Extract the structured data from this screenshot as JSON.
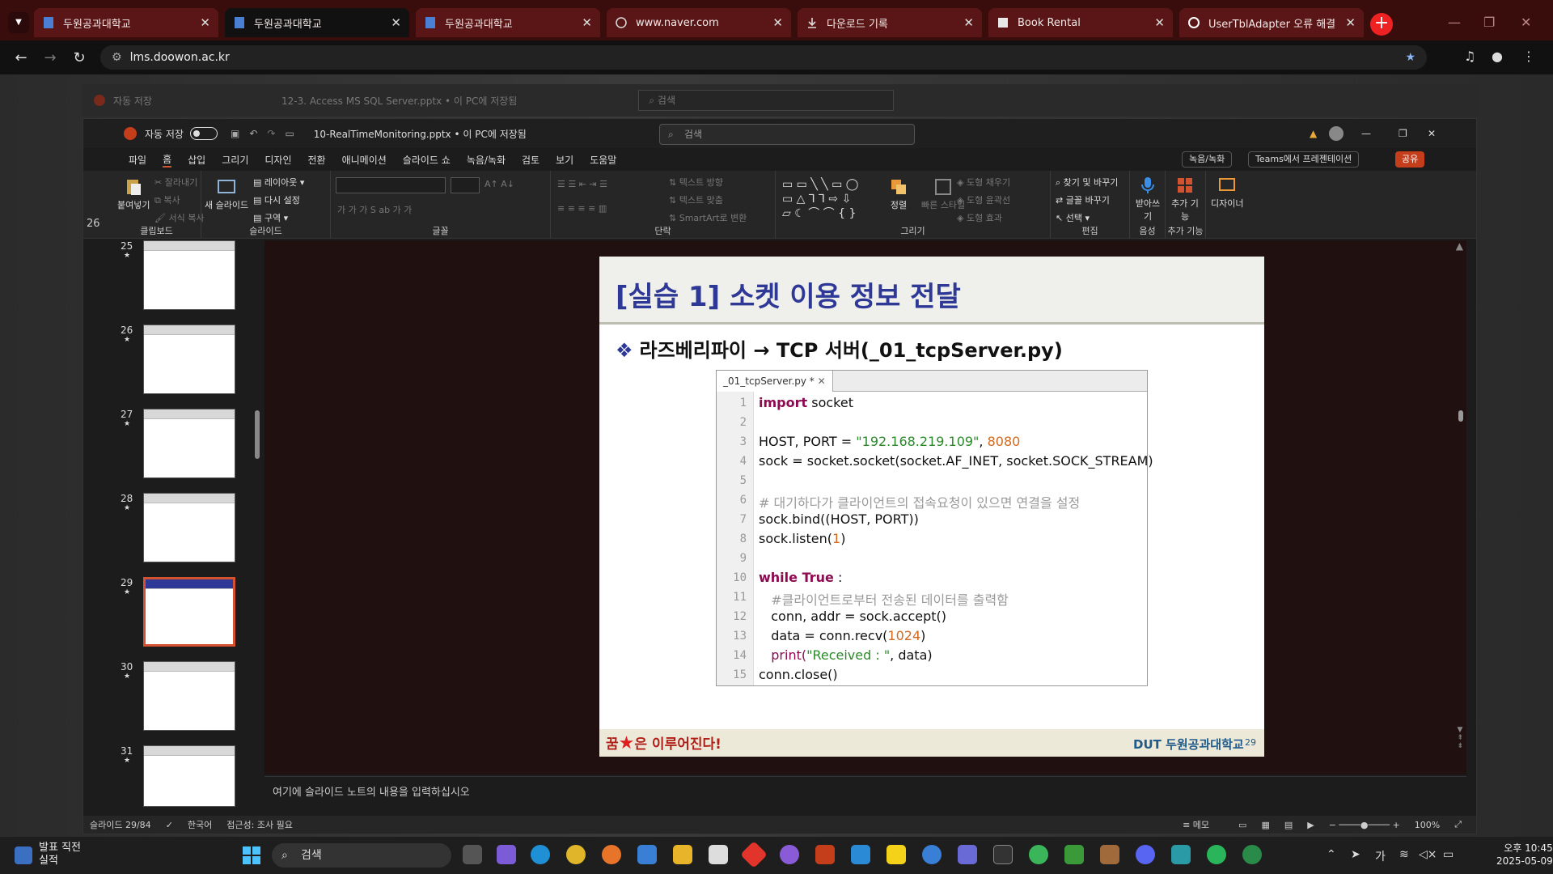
{
  "browser": {
    "tabs": [
      {
        "title": "두원공과대학교",
        "active": false
      },
      {
        "title": "두원공과대학교",
        "active": true
      },
      {
        "title": "두원공과대학교",
        "active": false
      },
      {
        "title": "www.naver.com",
        "active": false
      },
      {
        "title": "다운로드 기록",
        "active": false
      },
      {
        "title": "Book Rental",
        "active": false
      },
      {
        "title": "UserTblAdapter 오류 해결",
        "active": false
      }
    ],
    "url": "lms.doowon.ac.kr"
  },
  "back_window": {
    "autosave": "자동 저장",
    "filename": "12-3. Access MS SQL Server.pptx • 이 PC에 저장됨",
    "search": "검색"
  },
  "ppt": {
    "autosave_label": "자동 저장",
    "toggle_state": "끔",
    "filename": "10-RealTimeMonitoring.pptx • 이 PC에 저장됨",
    "search_placeholder": "검색",
    "menu": [
      "파일",
      "홈",
      "삽입",
      "그리기",
      "디자인",
      "전환",
      "애니메이션",
      "슬라이드 쇼",
      "녹음/녹화",
      "검토",
      "보기",
      "도움말"
    ],
    "buttons": {
      "record": "녹음/녹화",
      "teams": "Teams에서 프레젠테이션",
      "share": "공유"
    },
    "ribbon": {
      "groups": [
        "클립보드",
        "슬라이드",
        "글꼴",
        "단락",
        "그리기",
        "편집",
        "음성",
        "추가 기능"
      ],
      "paste": "붙여넣기",
      "cut": "잘라내기",
      "copy": "복사",
      "format_copy": "서식 복사",
      "new_slide": "새 슬라이드",
      "layout": "레이아웃",
      "reset": "다시 설정",
      "section": "구역",
      "text_direction": "텍스트 방향",
      "text_align": "텍스트 맞춤",
      "smartart": "SmartArt로 변환",
      "arrange": "정렬",
      "quick_styles": "빠른 스타일",
      "shape_fill": "도형 채우기",
      "shape_outline": "도형 윤곽선",
      "shape_effects": "도형 효과",
      "find": "찾기 및 바꾸기",
      "replace": "글꼴 바꾸기",
      "select": "선택",
      "dictate": "받아쓰기",
      "addins": "추가 기능",
      "designer": "디자이너"
    },
    "left_numbers": [
      "26",
      "27",
      "28",
      "29",
      "30"
    ],
    "thumbnails": [
      {
        "num": "25",
        "selected": false
      },
      {
        "num": "26",
        "selected": false
      },
      {
        "num": "27",
        "selected": false
      },
      {
        "num": "28",
        "selected": false
      },
      {
        "num": "29",
        "selected": true
      },
      {
        "num": "30",
        "selected": false
      },
      {
        "num": "31",
        "selected": false
      }
    ],
    "slide": {
      "title": "[실습 1] 소켓 이용 정보 전달",
      "bullet_bullet": "❖",
      "bullet_text": "라즈베리파이 → TCP 서버(_01_tcpServer.py)",
      "editor_tab": "_01_tcpServer.py *",
      "line_numbers": [
        "1",
        "2",
        "3",
        "4",
        "5",
        "6",
        "7",
        "8",
        "9",
        "10",
        "11",
        "12",
        "13",
        "14",
        "15"
      ],
      "code": {
        "l1_kw": "import",
        "l1_rest": " socket",
        "l3_a": "HOST, PORT = ",
        "l3_str": "\"192.168.219.109\"",
        "l3_b": ", ",
        "l3_num": "8080",
        "l4": "sock = socket.socket(socket.AF_INET, socket.SOCK_STREAM)",
        "l6": "# 대기하다가 클라이언트의 접속요청이 있으면 연결을 설정",
        "l7": "sock.bind((HOST, PORT))",
        "l8_a": "sock.listen(",
        "l8_num": "1",
        "l8_b": ")",
        "l10_kw": "while True",
        "l10_rest": " :",
        "l11": "   #클라이언트로부터 전송된 데이터를 출력함",
        "l12": "   conn, addr = sock.accept()",
        "l13_a": "   data = conn.recv(",
        "l13_num": "1024",
        "l13_b": ")",
        "l14_fn": "   print(",
        "l14_str": "\"Received : \"",
        "l14_b": ", data)",
        "l15": "conn.close()"
      },
      "motto_a": "꿈",
      "motto_star": "★",
      "motto_b": "은 이루어진다!",
      "footer_logo": "DUT 두원공과대학교",
      "page_number": "29"
    },
    "notes_placeholder": "여기에 슬라이드 노트의 내용을 입력하십시오",
    "status": {
      "slide": "슬라이드 29/84",
      "language": "한국어",
      "accessibility": "접근성: 조사 필요",
      "memo": "메모",
      "zoom": "100%"
    }
  },
  "taskbar": {
    "notice_line1": "발표 직전",
    "notice_line2": "실적",
    "search": "검색",
    "ime": "가",
    "time": "오후 10:45",
    "date": "2025-05-09"
  }
}
